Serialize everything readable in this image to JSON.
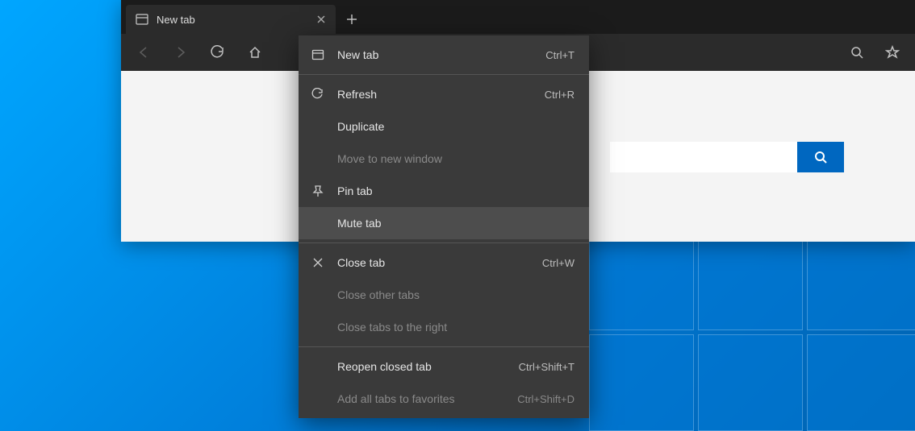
{
  "tab": {
    "title": "New tab"
  },
  "search": {
    "placeholder": ""
  },
  "context_menu": {
    "items": [
      {
        "label": "New tab",
        "shortcut": "Ctrl+T",
        "icon": "new-tab",
        "enabled": true,
        "sep_after": true
      },
      {
        "label": "Refresh",
        "shortcut": "Ctrl+R",
        "icon": "refresh",
        "enabled": true
      },
      {
        "label": "Duplicate",
        "shortcut": "",
        "icon": "",
        "enabled": true
      },
      {
        "label": "Move to new window",
        "shortcut": "",
        "icon": "",
        "enabled": false
      },
      {
        "label": "Pin tab",
        "shortcut": "",
        "icon": "pin",
        "enabled": true
      },
      {
        "label": "Mute tab",
        "shortcut": "",
        "icon": "",
        "enabled": true,
        "hover": true,
        "sep_after": true
      },
      {
        "label": "Close tab",
        "shortcut": "Ctrl+W",
        "icon": "close",
        "enabled": true
      },
      {
        "label": "Close other tabs",
        "shortcut": "",
        "icon": "",
        "enabled": false
      },
      {
        "label": "Close tabs to the right",
        "shortcut": "",
        "icon": "",
        "enabled": false,
        "sep_after": true
      },
      {
        "label": "Reopen closed tab",
        "shortcut": "Ctrl+Shift+T",
        "icon": "",
        "enabled": true
      },
      {
        "label": "Add all tabs to favorites",
        "shortcut": "Ctrl+Shift+D",
        "icon": "",
        "enabled": false
      }
    ]
  }
}
